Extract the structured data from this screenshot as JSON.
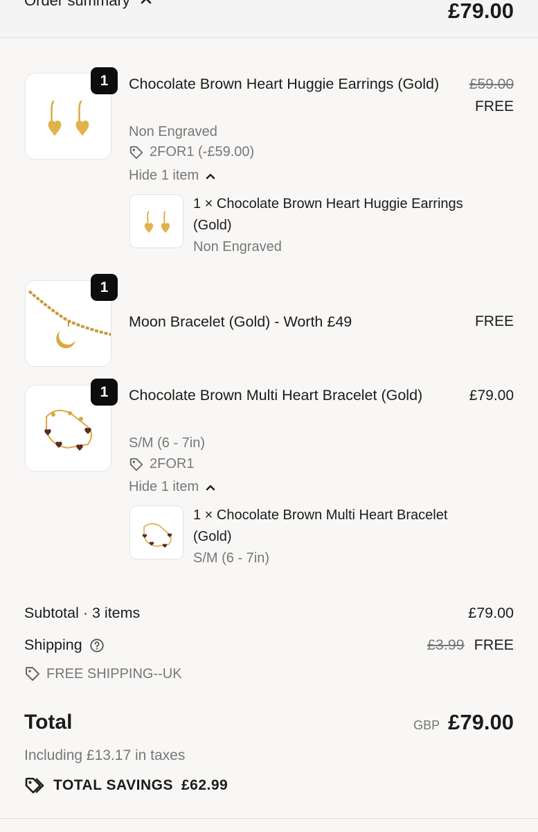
{
  "header": {
    "toggle_label": "Order summary",
    "total": "£79.00"
  },
  "items": [
    {
      "qty": "1",
      "title": "Chocolate Brown Heart Huggie Earrings (Gold)",
      "variant": "Non Engraved",
      "discount": "2FOR1 (-£59.00)",
      "original_price": "£59.00",
      "price": "FREE",
      "hide_label": "Hide 1 item",
      "bundle": {
        "title": "1 × Chocolate Brown Heart Huggie Earrings (Gold)",
        "variant": "Non Engraved"
      }
    },
    {
      "qty": "1",
      "title": "Moon Bracelet (Gold) - Worth £49",
      "price": "FREE"
    },
    {
      "qty": "1",
      "title": "Chocolate Brown Multi Heart Bracelet (Gold)",
      "variant": "S/M (6 - 7in)",
      "discount": "2FOR1",
      "price": "£79.00",
      "hide_label": "Hide 1 item",
      "bundle": {
        "title": "1 × Chocolate Brown Multi Heart Bracelet (Gold)",
        "variant": "S/M (6 - 7in)"
      }
    }
  ],
  "summary": {
    "subtotal_label": "Subtotal · 3 items",
    "subtotal_value": "£79.00",
    "shipping_label": "Shipping",
    "shipping_original": "£3.99",
    "shipping_value": "FREE",
    "shipping_discount": "FREE SHIPPING--UK",
    "total_label": "Total",
    "currency": "GBP",
    "total_value": "£79.00",
    "taxes": "Including £13.17 in taxes",
    "savings_label": "TOTAL SAVINGS",
    "savings_value": "£62.99"
  },
  "colors": {
    "background": "#f8f7f6",
    "badge": "#0d0d0d",
    "muted_text": "#777777",
    "gold": "#d9a93e",
    "brown_heart": "#5a2a22"
  },
  "icons": [
    "chevron-up-icon",
    "tag-icon",
    "help-circle-icon",
    "tags-icon"
  ]
}
